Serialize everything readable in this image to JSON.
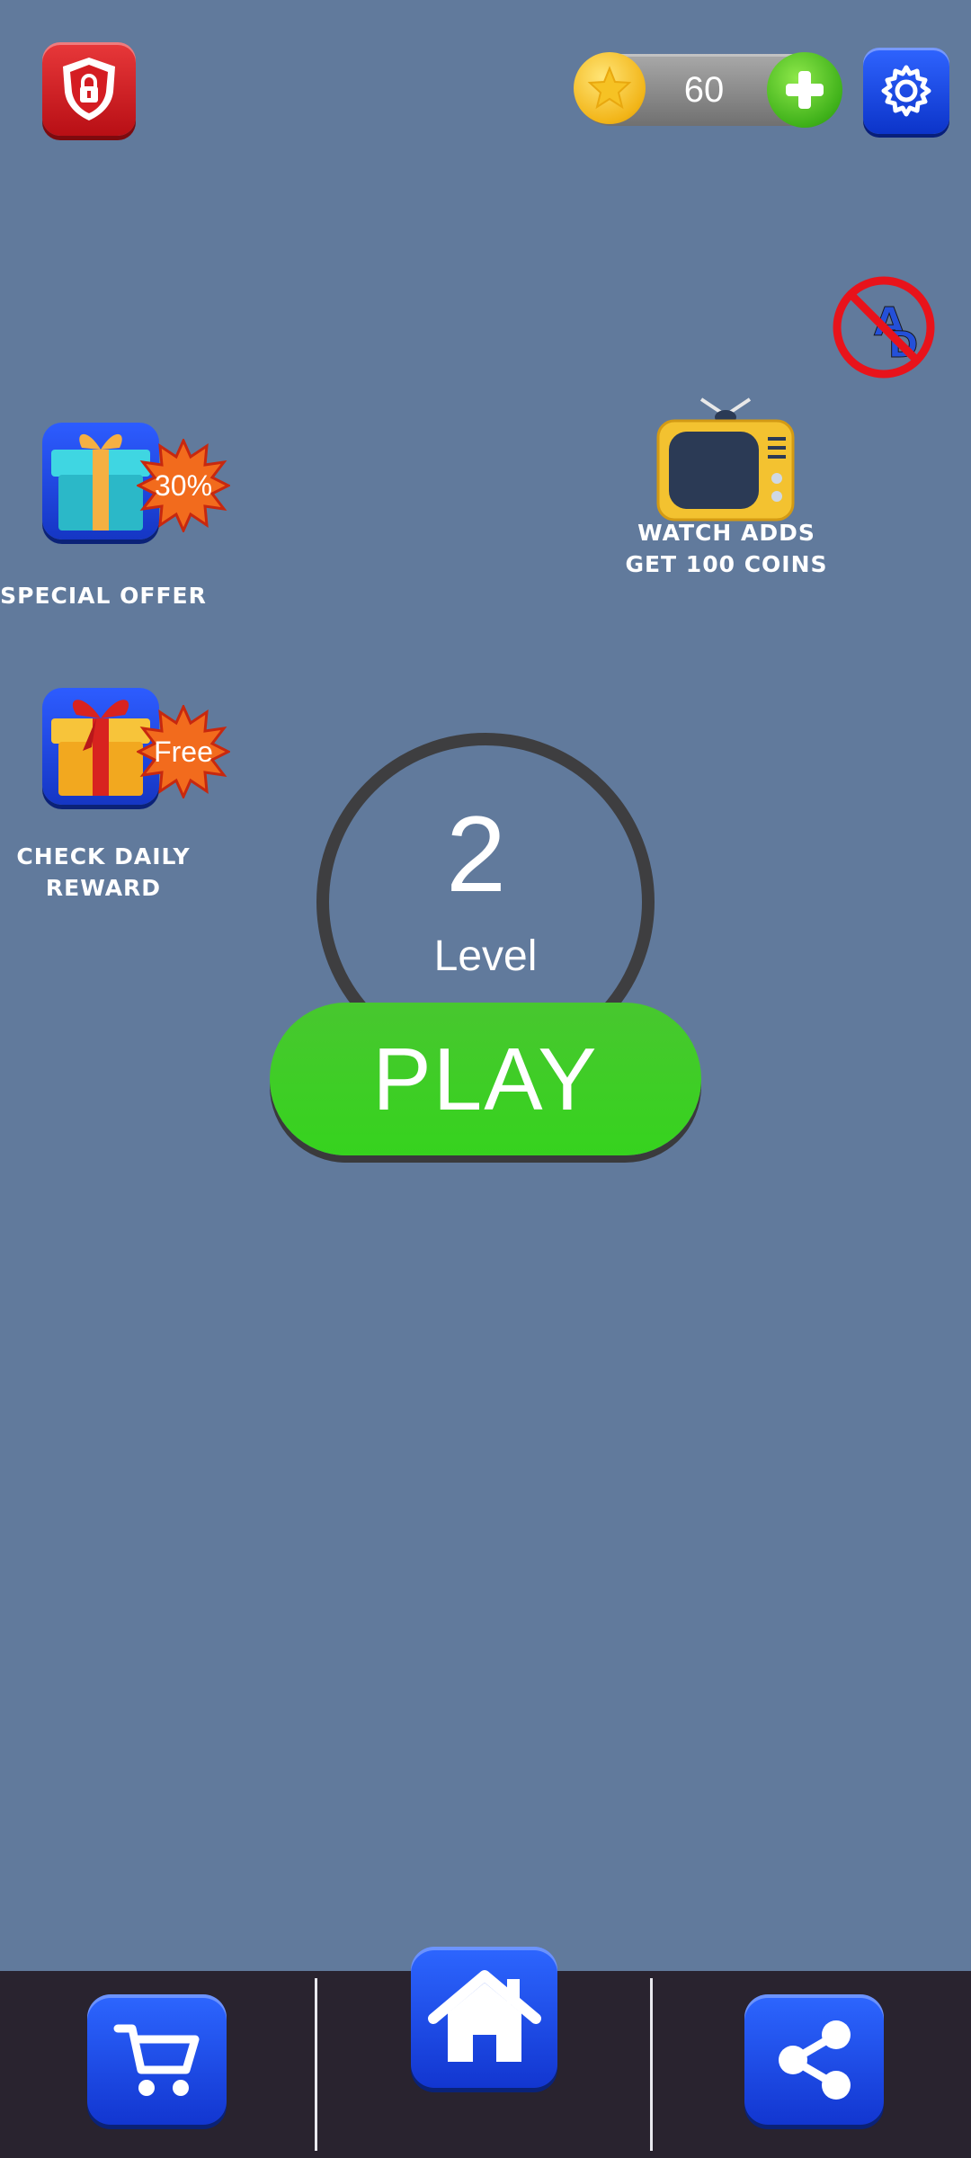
{
  "header": {
    "privacy_icon": "shield-lock-icon",
    "coins": "60",
    "coin_icon": "star-coin-icon",
    "add_icon": "plus-icon",
    "settings_icon": "gear-icon"
  },
  "no_ads": {
    "icon": "no-ads-icon",
    "text": "AD"
  },
  "special_offer": {
    "badge": "30%",
    "label": "SPECIAL OFFER",
    "icon": "gift-icon"
  },
  "daily_reward": {
    "badge": "Free",
    "label_line1": "CHECK DAILY",
    "label_line2": "REWARD",
    "icon": "gift-icon"
  },
  "watch_ads": {
    "icon": "tv-icon",
    "label_line1": "WATCH ADDS",
    "label_line2": "GET 100 COINS"
  },
  "level": {
    "number": "2",
    "label": "Level"
  },
  "play_label": "PLAY",
  "bottom_nav": {
    "shop_icon": "cart-icon",
    "home_icon": "home-icon",
    "share_icon": "share-icon"
  },
  "colors": {
    "background": "#617a9c",
    "play_green": "#3ec524",
    "nav_bar": "#29232f",
    "button_blue": "#1f4ee8"
  }
}
